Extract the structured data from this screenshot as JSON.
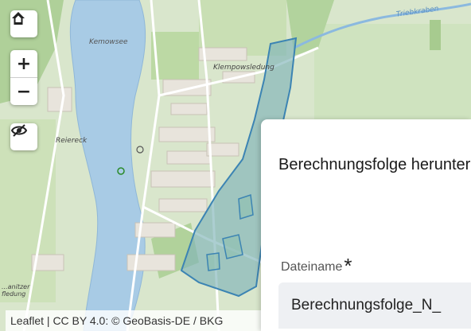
{
  "map": {
    "labels": {
      "lake": "Kemowsee",
      "village_north": "Klempowsledung",
      "village_west": "Reiereck",
      "stream": "Triebkraben",
      "corner": "...anitzer fledung"
    },
    "controls": {
      "home_icon": "home-icon",
      "zoom_in": "+",
      "zoom_out": "−",
      "layers_icon": "eye-slash-icon"
    },
    "attribution": "Leaflet | CC BY 4.0: © GeoBasis-DE / BKG"
  },
  "dialog": {
    "title": "Berechnungsfolge herunterladen",
    "filename_label": "Dateiname",
    "required_mark": "*",
    "filename_value": "Berechnungsfolge_N_"
  },
  "colors": {
    "water": "#a9cbe6",
    "land": "#d6e6c8",
    "forest": "#a9cd93",
    "polygon_fill": "#7fb3b8",
    "polygon_stroke": "#3c84b3"
  }
}
